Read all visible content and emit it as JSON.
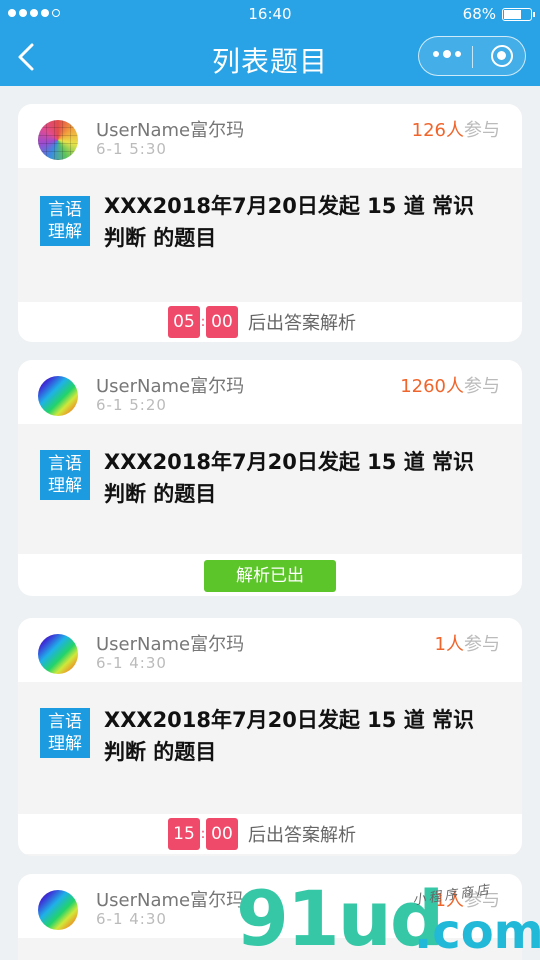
{
  "status_bar": {
    "time": "16:40",
    "battery": "68%"
  },
  "nav": {
    "title": "列表题目"
  },
  "cards": [
    {
      "username": "UserName富尔玛",
      "time": "6-1  5:30",
      "count": "126人",
      "count_suffix": "参与",
      "category_line1": "言语",
      "category_line2": "理解",
      "title": "XXX2018年7月20日发起 15 道 常识 判断 的题目",
      "timer_min": "05",
      "timer_sec": "00",
      "timer_label": "后出答案解析"
    },
    {
      "username": "UserName富尔玛",
      "time": "6-1  5:20",
      "count": "1260人",
      "count_suffix": "参与",
      "category_line1": "言语",
      "category_line2": "理解",
      "title": "XXX2018年7月20日发起 15 道 常识 判断 的题目",
      "analysis_label": "解析已出"
    },
    {
      "username": "UserName富尔玛",
      "time": "6-1  4:30",
      "count": "1人",
      "count_suffix": "参与",
      "category_line1": "言语",
      "category_line2": "理解",
      "title": "XXX2018年7月20日发起 15 道 常识 判断 的题目",
      "timer_min": "15",
      "timer_sec": "00",
      "timer_label": "后出答案解析"
    },
    {
      "username": "UserName富尔玛",
      "time": "6-1  4:30",
      "count": "1人",
      "count_suffix": "参与"
    }
  ],
  "watermark": {
    "main": "91ud",
    "domain": ".com",
    "tagline": "小程序商店"
  },
  "colors": {
    "header": "#29a3e5",
    "category": "#1d9be0",
    "count": "#f0652b",
    "timer": "#ef4a6a",
    "analysis": "#5cc52a"
  }
}
